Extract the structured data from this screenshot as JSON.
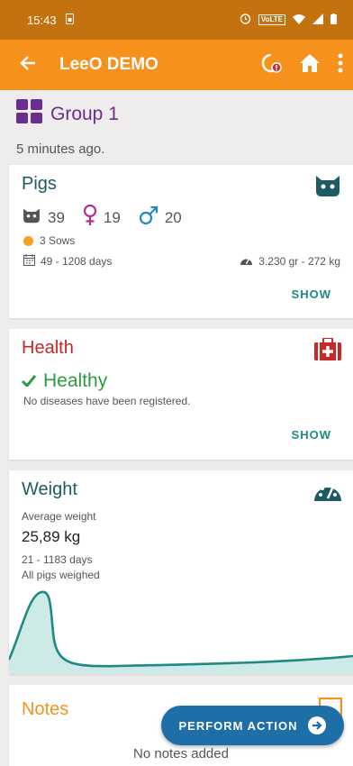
{
  "status_bar": {
    "time": "15:43",
    "network": "VoLTE"
  },
  "app_bar": {
    "title": "LeeO DEMO"
  },
  "group": {
    "name": "Group 1",
    "updated": "5 minutes ago."
  },
  "pigs": {
    "title": "Pigs",
    "total": "39",
    "female": "19",
    "male": "20",
    "sows": "3 Sows",
    "days": "49 - 1208 days",
    "weight_range": "3.230 gr - 272 kg",
    "show_label": "SHOW"
  },
  "health": {
    "title": "Health",
    "status": "Healthy",
    "subtitle": "No diseases have been registered.",
    "show_label": "SHOW"
  },
  "weight": {
    "title": "Weight",
    "avg_label": "Average weight",
    "avg_value": "25,89 kg",
    "days": "21 - 1183 days",
    "weighed": "All pigs weighed"
  },
  "notes": {
    "title": "Notes",
    "empty_text": "No notes added"
  },
  "fab": {
    "label": "PERFORM ACTION"
  },
  "colors": {
    "status_bar": "#c4710f",
    "app_bar": "#f6911c",
    "group_purple": "#6b2d8f",
    "teal": "#1e5a64",
    "health_red": "#c62828",
    "healthy_green": "#2e9b3f",
    "notes_orange": "#f6911c",
    "fab_blue": "#1e6fa8"
  }
}
